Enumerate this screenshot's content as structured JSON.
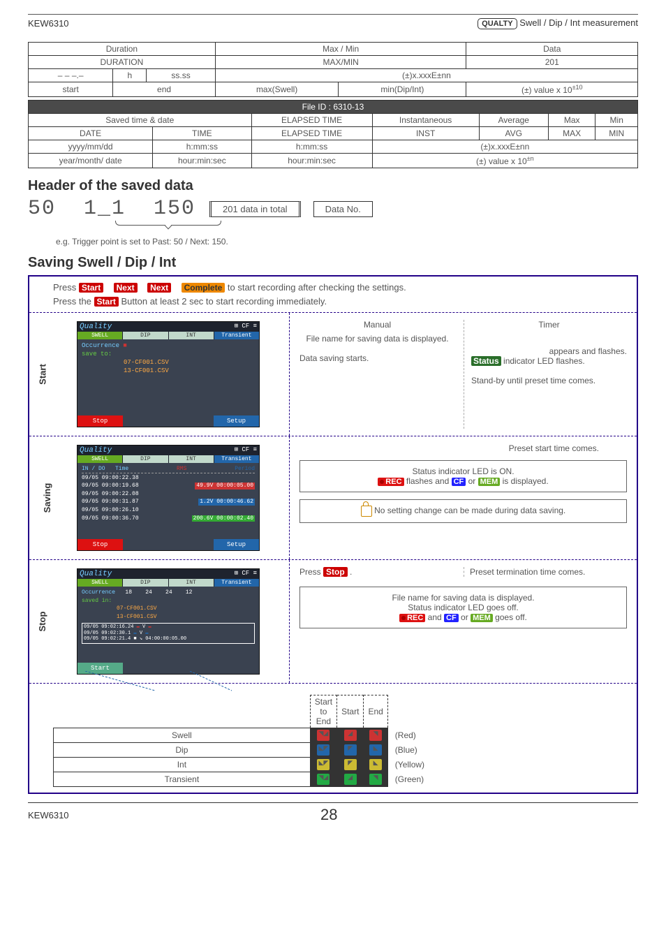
{
  "header": {
    "model": "KEW6310",
    "badge": "QUALTY",
    "section": "Swell / Dip / Int measurement"
  },
  "tableA": {
    "r1c1": "Duration",
    "r1c2": "Max / Min",
    "r1c3": "Data",
    "r2c1": "DURATION",
    "r2c2": "MAX/MIN",
    "r2c3": "201",
    "r3c1": "– – –.–",
    "r3c2": "h",
    "r3c3": "ss.ss",
    "r3c4": "(±)x.xxxE±nn",
    "r4c1": "start",
    "r4c2": "end",
    "r4c3": "max(Swell)",
    "r4c4": "min(Dip/Int)",
    "r4c5_prefix": "(±) value x 10",
    "r4c5_exp": "±10"
  },
  "tableB": {
    "title": "File ID : 6310-13",
    "r1c1": "Saved time & date",
    "r1c2": "ELAPSED TIME",
    "r1c3": "Instantaneous",
    "r1c4": "Average",
    "r1c5": "Max",
    "r1c6": "Min",
    "r2c1": "DATE",
    "r2c2": "TIME",
    "r2c3": "ELAPSED TIME",
    "r2c4": "INST",
    "r2c5": "AVG",
    "r2c6": "MAX",
    "r2c7": "MIN",
    "r3c1": "yyyy/mm/dd",
    "r3c2": "h:mm:ss",
    "r3c3": "h:mm:ss",
    "r3c4": "(±)x.xxxE±nn",
    "r4c1": "year/month/ date",
    "r4c2": "hour:min:sec",
    "r4c3": "hour:min:sec",
    "r4c4_prefix": "(±) value x 10",
    "r4c4_exp": "±n"
  },
  "savedHeader": {
    "title": "Header of the saved data",
    "seg1": "50",
    "seg2": "1_1",
    "seg3": "150",
    "label1": "201 data in total",
    "label2": "Data No.",
    "note": "e.g. Trigger point is set to Past: 50 / Next: 150."
  },
  "saving": {
    "title": "Saving Swell / Dip / Int",
    "intro1_a": "Press ",
    "intro1_b": " to start recording after checking the settings.",
    "intro2_a": "Press the ",
    "intro2_b": " Button at least 2 sec to start recording immediately.",
    "btn_start": "Start",
    "btn_next": "Next",
    "btn_complete": "Complete",
    "btn_stop": "Stop",
    "labels": {
      "start": "Start",
      "saving": "Saving",
      "stop": "Stop"
    },
    "startRow": {
      "manual_h": "Manual",
      "timer_h": "Timer",
      "manual_t1": "File name for saving data is displayed.",
      "manual_t2": "Data saving starts.",
      "timer_t1": "appears and flashes.",
      "status_label": "Status",
      "timer_t1b": "ndicator LED flashes.",
      "timer_t2": "Stand-by until preset time comes."
    },
    "savingRow": {
      "t0": "Preset start time comes.",
      "t1": "Status indicator LED is ON.",
      "t2a": " flashes and ",
      "t2b": " or ",
      "t2c": " is displayed.",
      "t3": "No setting change can be made during data saving."
    },
    "stopRow": {
      "p1a": "Press ",
      "p1b": ".",
      "p1c": "Preset termination time comes.",
      "t1": "File name for saving data is displayed.",
      "t2": "Status indicator LED goes off.",
      "t3a": " and ",
      "t3b": " or ",
      "t3c": " goes off."
    },
    "legend": {
      "h1": "Start to End",
      "h2": "Start",
      "h3": "End",
      "rows": [
        "Swell",
        "Dip",
        "Int",
        "Transient"
      ],
      "colors": [
        "(Red)",
        "(Blue)",
        "(Yellow)",
        "(Green)"
      ]
    },
    "badges": {
      "rec": "REC",
      "cf": "CF",
      "mem": "MEM"
    }
  },
  "footer": {
    "model": "KEW6310",
    "page": "28"
  }
}
